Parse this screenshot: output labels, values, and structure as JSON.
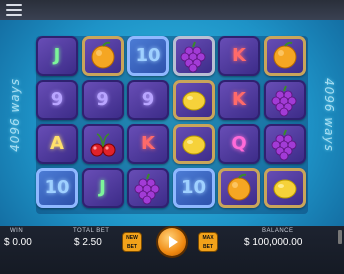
{
  "grid": [
    [
      {
        "symbol": "J",
        "frame": "plain",
        "color": "#7cf59a"
      },
      {
        "symbol": "9",
        "frame": "plain",
        "color": "#b8a4ff"
      },
      {
        "symbol": "A",
        "frame": "plain",
        "color": "#ffe06b"
      },
      {
        "symbol": "10",
        "frame": "blue",
        "color": "#9fd0ff"
      }
    ],
    [
      {
        "symbol": "orange",
        "frame": "gold"
      },
      {
        "symbol": "9",
        "frame": "plain",
        "color": "#b8a4ff"
      },
      {
        "symbol": "cherries",
        "frame": "plain"
      },
      {
        "symbol": "J",
        "frame": "plain",
        "color": "#7cf59a"
      }
    ],
    [
      {
        "symbol": "10",
        "frame": "blue",
        "color": "#9fd0ff"
      },
      {
        "symbol": "9",
        "frame": "plain",
        "color": "#b8a4ff"
      },
      {
        "symbol": "K",
        "frame": "plain",
        "color": "#ff6a6a"
      },
      {
        "symbol": "grapes",
        "frame": "plain"
      }
    ],
    [
      {
        "symbol": "grapes",
        "frame": "silver"
      },
      {
        "symbol": "lemon",
        "frame": "gold"
      },
      {
        "symbol": "lemon",
        "frame": "gold"
      },
      {
        "symbol": "10",
        "frame": "blue",
        "color": "#9fd0ff"
      }
    ],
    [
      {
        "symbol": "K",
        "frame": "plain",
        "color": "#ff6a6a"
      },
      {
        "symbol": "K",
        "frame": "plain",
        "color": "#ff6a6a"
      },
      {
        "symbol": "Q",
        "frame": "plain",
        "color": "#ff6ad8"
      },
      {
        "symbol": "orange",
        "frame": "gold"
      }
    ],
    [
      {
        "symbol": "orange",
        "frame": "gold"
      },
      {
        "symbol": "grapes",
        "frame": "plain"
      },
      {
        "symbol": "grapes",
        "frame": "plain"
      },
      {
        "symbol": "lemon",
        "frame": "gold"
      }
    ]
  ],
  "ways_text": "4096 ways",
  "footer": {
    "win_label": "WIN",
    "win_value": "$ 0.00",
    "total_bet_label": "TOTAL BET",
    "total_bet_value": "$ 2.50",
    "new_bet_line1": "NEW",
    "new_bet_line2": "BET",
    "max_bet_line1": "MAX",
    "max_bet_line2": "BET",
    "balance_label": "BALANCE",
    "balance_value": "$ 100,000.00"
  },
  "colors": {
    "accent": "#f2a21a",
    "bg": "#1e93c7"
  }
}
